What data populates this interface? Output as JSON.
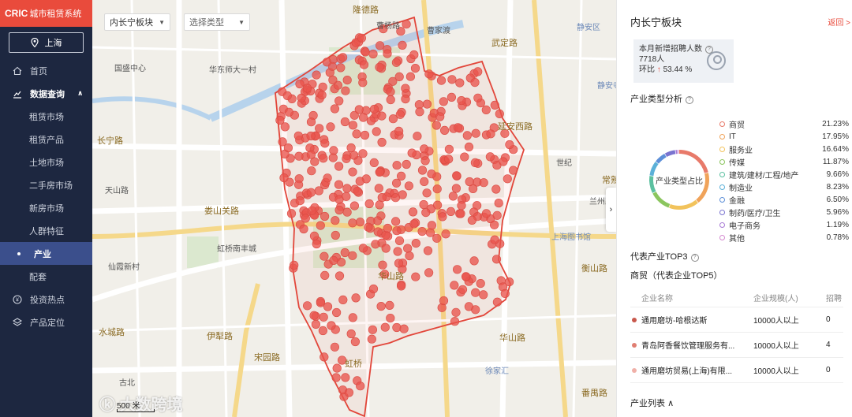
{
  "brand": {
    "short": "CRIC",
    "name": "城市租赁系统"
  },
  "city": {
    "label": "上海"
  },
  "nav": {
    "home": "首页",
    "data_query": "数据查询",
    "sub_items": [
      {
        "label": "租赁市场"
      },
      {
        "label": "租赁产品"
      },
      {
        "label": "土地市场"
      },
      {
        "label": "二手房市场"
      },
      {
        "label": "新房市场"
      },
      {
        "label": "人群特征"
      },
      {
        "label": "产业"
      },
      {
        "label": "配套"
      }
    ],
    "active_sub": "产业",
    "invest": "投资热点",
    "product": "产品定位"
  },
  "map": {
    "block_select": "内长宁板块",
    "type_select": "选择类型",
    "scale": "500 米",
    "watermark": "大数跨境",
    "labels": [
      {
        "text": "隆德路"
      },
      {
        "text": "曹杨路"
      },
      {
        "text": "曹家渡"
      },
      {
        "text": "武定路"
      },
      {
        "text": "静安区"
      },
      {
        "text": "静安寺"
      },
      {
        "text": "华东师大一村"
      },
      {
        "text": "国盛中心"
      },
      {
        "text": "长宁路"
      },
      {
        "text": "天山路"
      },
      {
        "text": "娄山关路"
      },
      {
        "text": "虹桥南丰城"
      },
      {
        "text": "仙霞新村"
      },
      {
        "text": "伊犁路"
      },
      {
        "text": "水城路"
      },
      {
        "text": "宋园路"
      },
      {
        "text": "古北"
      },
      {
        "text": "虹桥"
      },
      {
        "text": "华山路"
      },
      {
        "text": "衡山路"
      },
      {
        "text": "上海图书馆"
      },
      {
        "text": "徐家汇"
      },
      {
        "text": "华山路"
      },
      {
        "text": "兰州路"
      },
      {
        "text": "常熟路"
      },
      {
        "text": "番禺路"
      },
      {
        "text": "世纪"
      },
      {
        "text": "延安西路"
      }
    ]
  },
  "panel": {
    "title": "内长宁板块",
    "back": "返回 >",
    "kpi": {
      "label": "本月新增招聘人数",
      "value": "7718人",
      "change_label": "环比",
      "change_value": "53.44 %"
    },
    "industry_title": "产业类型分析",
    "donut_center": "产业类型占比",
    "industries": [
      {
        "name": "商贸",
        "pct": "21.23%",
        "color": "#e87a6a"
      },
      {
        "name": "IT",
        "pct": "17.95%",
        "color": "#f0a35a"
      },
      {
        "name": "服务业",
        "pct": "16.64%",
        "color": "#f2c35c"
      },
      {
        "name": "传媒",
        "pct": "11.87%",
        "color": "#8bc55e"
      },
      {
        "name": "建筑/建材/工程/地产",
        "pct": "9.66%",
        "color": "#5cc0a0"
      },
      {
        "name": "制造业",
        "pct": "8.23%",
        "color": "#5bb0d8"
      },
      {
        "name": "金融",
        "pct": "6.50%",
        "color": "#5d8fd8"
      },
      {
        "name": "制药/医疗/卫生",
        "pct": "5.96%",
        "color": "#7a74d0"
      },
      {
        "name": "电子商务",
        "pct": "1.19%",
        "color": "#a87ad6"
      },
      {
        "name": "其他",
        "pct": "0.78%",
        "color": "#d48ad0"
      }
    ],
    "top3_title": "代表产业TOP3",
    "top5_title": "商贸（代表企业TOP5）",
    "table": {
      "headers": [
        "企业名称",
        "企业规模(人)",
        "招聘"
      ],
      "rows": [
        {
          "name": "通用磨坊-哈根达斯",
          "size": "10000人以上",
          "count": "0",
          "color": "#c8584c"
        },
        {
          "name": "青岛阿香餐饮管理服务有...",
          "size": "10000人以上",
          "count": "4",
          "color": "#e07e72"
        },
        {
          "name": "通用磨坊贸易(上海)有限...",
          "size": "10000人以上",
          "count": "0",
          "color": "#f0b0a8"
        }
      ]
    },
    "industry_list": "产业列表"
  }
}
